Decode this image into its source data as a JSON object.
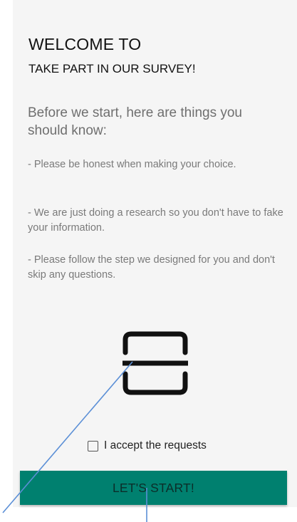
{
  "header": {
    "title": "WELCOME TO",
    "subtitle": "TAKE PART IN OUR SURVEY!"
  },
  "intro": {
    "text": "Before we start, here are things you should know:"
  },
  "rules": [
    "- Please be honest when making your choice.",
    "- We are just doing a research so you don't have to fake your information.",
    "- Please follow the step we designed for you and don't skip any questions."
  ],
  "icon": {
    "name": "scan-icon"
  },
  "consent": {
    "label": "I accept the requests",
    "checked": false
  },
  "actions": {
    "start_label": "LET'S START!"
  },
  "colors": {
    "background": "#f5f5f5",
    "accent": "#00806f",
    "button_text": "#0c2d29",
    "annotation_line": "#5b8fd6"
  }
}
